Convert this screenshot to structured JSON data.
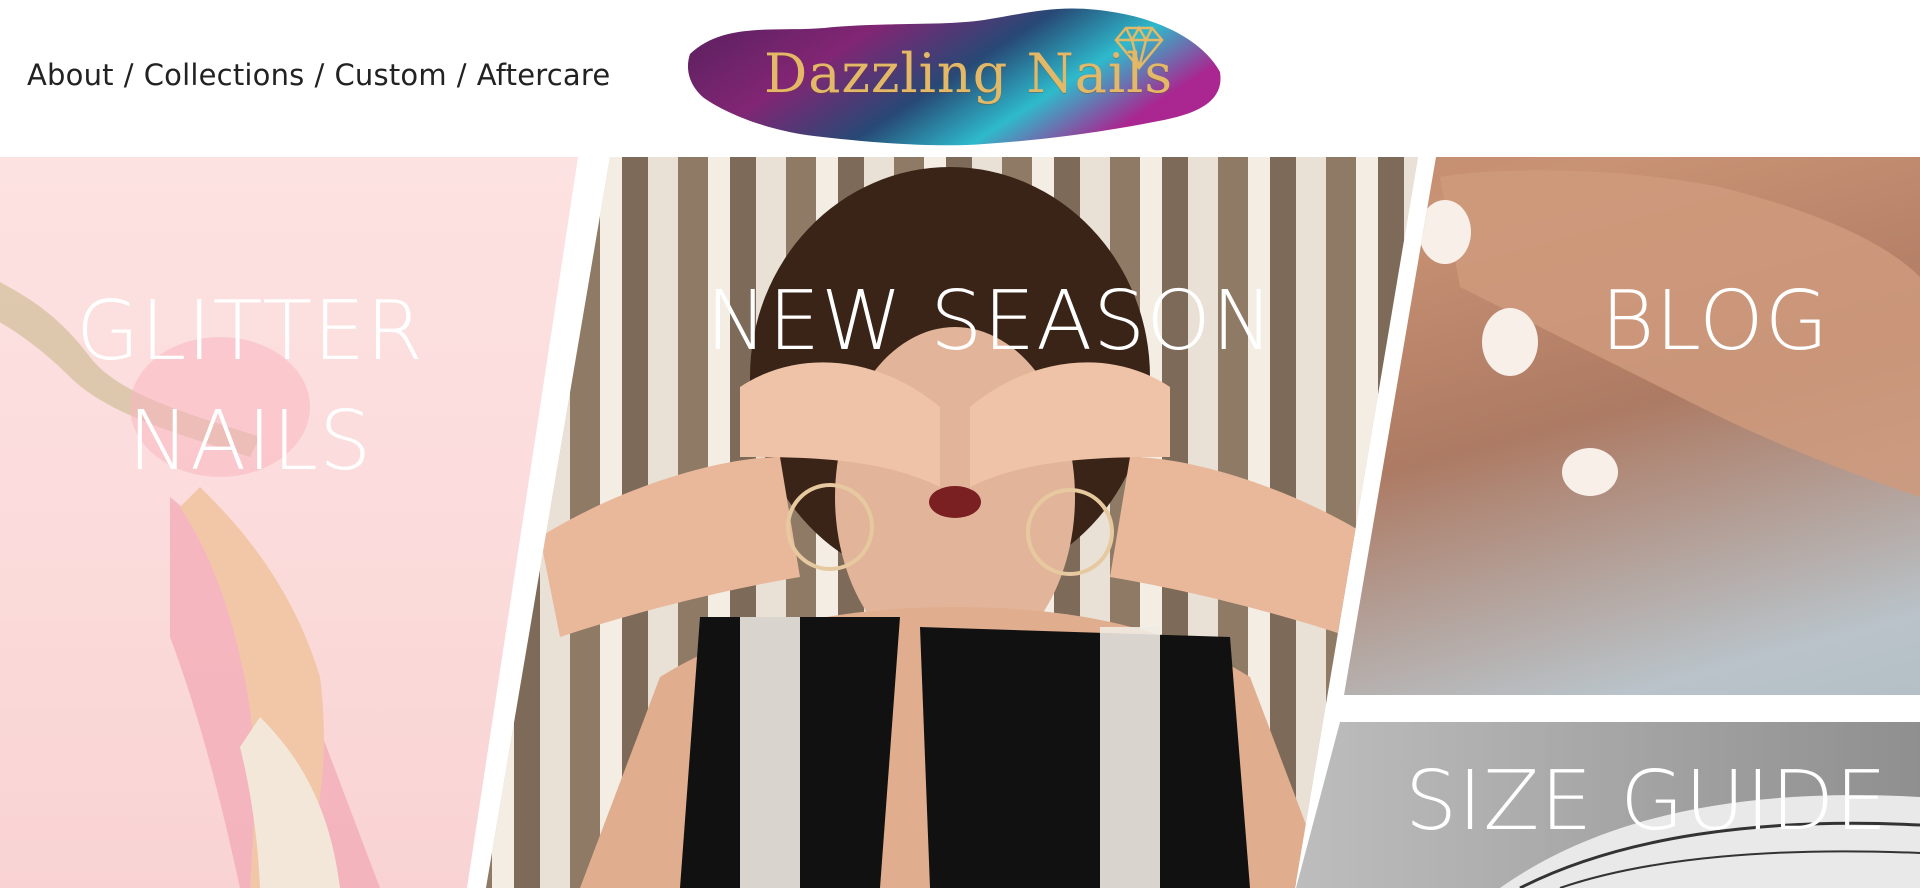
{
  "nav": {
    "items": [
      "About",
      "Collections",
      "Custom",
      "Aftercare"
    ],
    "separator": "/"
  },
  "logo": {
    "text": "Dazzling Nails",
    "icon": "diamond-icon",
    "brand_colors": [
      "#7b1a6d",
      "#23b6c9",
      "#e3b866"
    ]
  },
  "tiles": [
    {
      "label": "GLITTER NAILS"
    },
    {
      "label": "NEW SEASON"
    },
    {
      "label": "BLOG"
    },
    {
      "label": "SIZE GUIDE"
    }
  ]
}
